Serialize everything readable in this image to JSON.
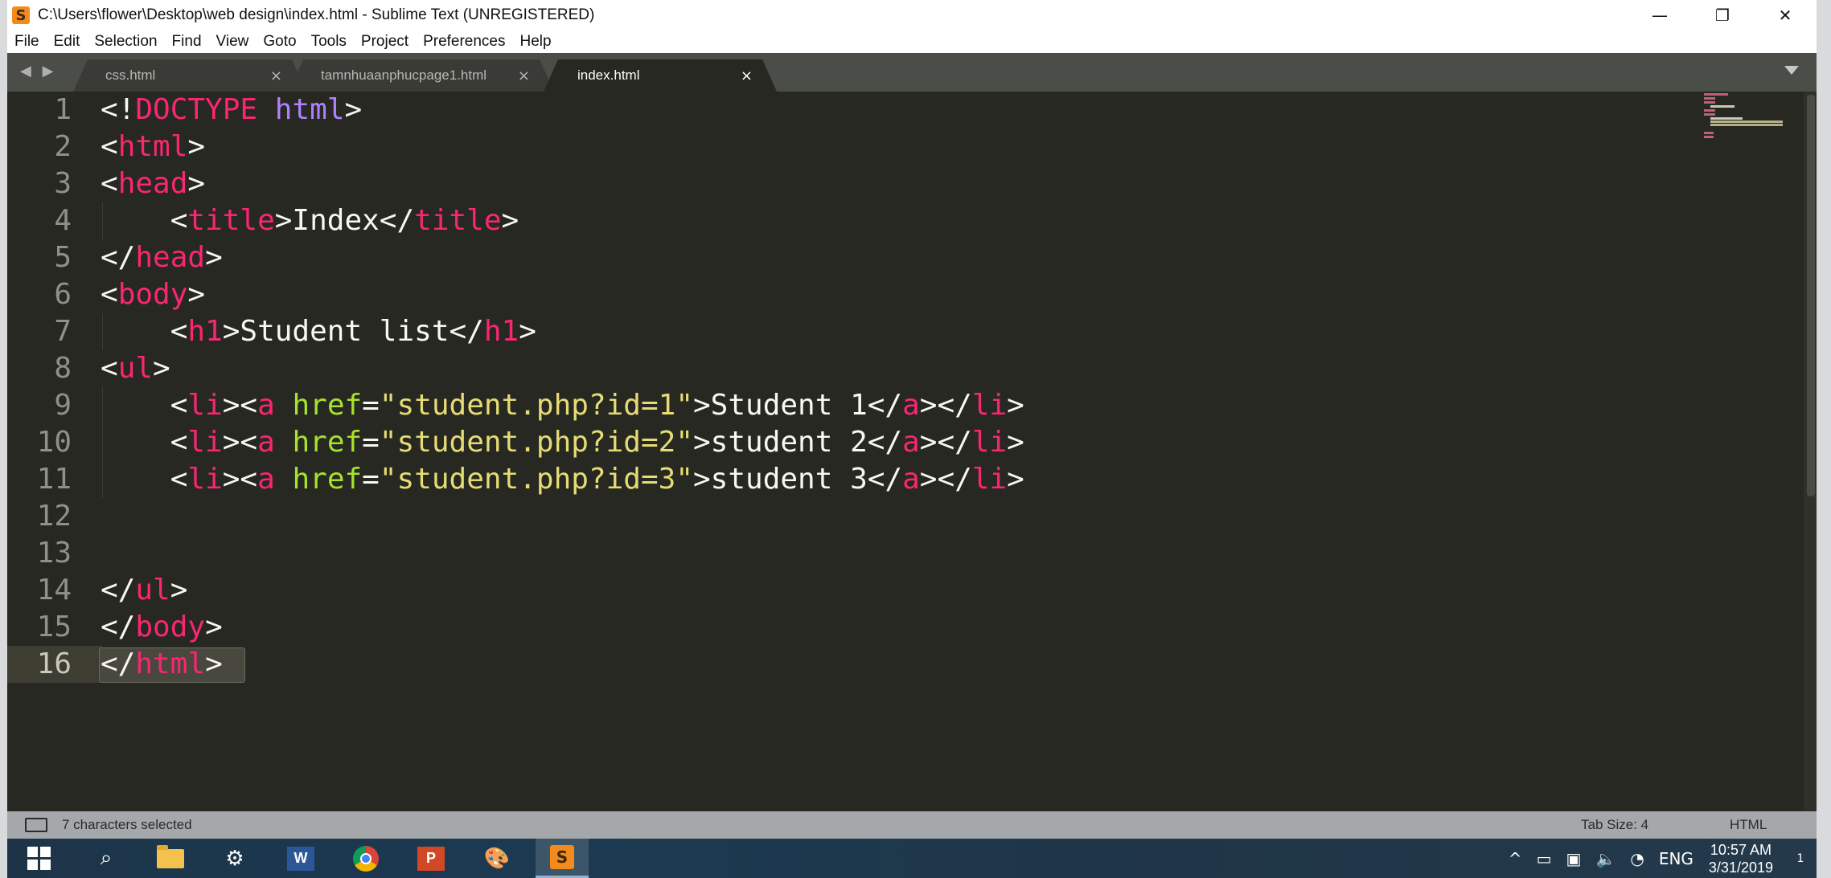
{
  "window": {
    "title": "C:\\Users\\flower\\Desktop\\web design\\index.html - Sublime Text (UNREGISTERED)",
    "app_icon_glyph": "S",
    "controls": {
      "minimize": "—",
      "restore": "❐",
      "close": "✕"
    }
  },
  "menu": [
    "File",
    "Edit",
    "Selection",
    "Find",
    "View",
    "Goto",
    "Tools",
    "Project",
    "Preferences",
    "Help"
  ],
  "tabs": {
    "nav_arrows": "◀ ▶",
    "items": [
      {
        "label": "css.html",
        "close": "×"
      },
      {
        "label": "tamnhuaanphucpage1.html",
        "close": "×"
      },
      {
        "label": "index.html",
        "close": "×",
        "active": true
      }
    ]
  },
  "editor": {
    "current_line": 16,
    "lines": [
      {
        "n": "1",
        "tokens": [
          {
            "t": "<!",
            "c": "plain"
          },
          {
            "t": "DOCTYPE",
            "c": "tag"
          },
          {
            "t": " ",
            "c": "plain"
          },
          {
            "t": "html",
            "c": "kw"
          },
          {
            "t": ">",
            "c": "plain"
          }
        ]
      },
      {
        "n": "2",
        "tokens": [
          {
            "t": "<",
            "c": "plain"
          },
          {
            "t": "html",
            "c": "tag"
          },
          {
            "t": ">",
            "c": "plain"
          }
        ]
      },
      {
        "n": "3",
        "tokens": [
          {
            "t": "<",
            "c": "plain"
          },
          {
            "t": "head",
            "c": "tag"
          },
          {
            "t": ">",
            "c": "plain"
          }
        ]
      },
      {
        "n": "4",
        "tokens": [
          {
            "t": "    <",
            "c": "plain"
          },
          {
            "t": "title",
            "c": "tag"
          },
          {
            "t": ">Index</",
            "c": "plain"
          },
          {
            "t": "title",
            "c": "tag"
          },
          {
            "t": ">",
            "c": "plain"
          }
        ]
      },
      {
        "n": "5",
        "tokens": [
          {
            "t": "</",
            "c": "plain"
          },
          {
            "t": "head",
            "c": "tag"
          },
          {
            "t": ">",
            "c": "plain"
          }
        ]
      },
      {
        "n": "6",
        "tokens": [
          {
            "t": "<",
            "c": "plain"
          },
          {
            "t": "body",
            "c": "tag"
          },
          {
            "t": ">",
            "c": "plain"
          }
        ]
      },
      {
        "n": "7",
        "tokens": [
          {
            "t": "    <",
            "c": "plain"
          },
          {
            "t": "h1",
            "c": "tag"
          },
          {
            "t": ">Student list</",
            "c": "plain"
          },
          {
            "t": "h1",
            "c": "tag"
          },
          {
            "t": ">",
            "c": "plain"
          }
        ]
      },
      {
        "n": "8",
        "tokens": [
          {
            "t": "<",
            "c": "plain"
          },
          {
            "t": "ul",
            "c": "tag"
          },
          {
            "t": ">",
            "c": "plain"
          }
        ]
      },
      {
        "n": "9",
        "tokens": [
          {
            "t": "    <",
            "c": "plain"
          },
          {
            "t": "li",
            "c": "tag"
          },
          {
            "t": "><",
            "c": "plain"
          },
          {
            "t": "a",
            "c": "tag"
          },
          {
            "t": " ",
            "c": "plain"
          },
          {
            "t": "href",
            "c": "attr"
          },
          {
            "t": "=",
            "c": "plain"
          },
          {
            "t": "\"student.php?id=1\"",
            "c": "str"
          },
          {
            "t": ">Student 1</",
            "c": "plain"
          },
          {
            "t": "a",
            "c": "tag"
          },
          {
            "t": "></",
            "c": "plain"
          },
          {
            "t": "li",
            "c": "tag"
          },
          {
            "t": ">",
            "c": "plain"
          }
        ]
      },
      {
        "n": "10",
        "tokens": [
          {
            "t": "    <",
            "c": "plain"
          },
          {
            "t": "li",
            "c": "tag"
          },
          {
            "t": "><",
            "c": "plain"
          },
          {
            "t": "a",
            "c": "tag"
          },
          {
            "t": " ",
            "c": "plain"
          },
          {
            "t": "href",
            "c": "attr"
          },
          {
            "t": "=",
            "c": "plain"
          },
          {
            "t": "\"student.php?id=2\"",
            "c": "str"
          },
          {
            "t": ">student 2</",
            "c": "plain"
          },
          {
            "t": "a",
            "c": "tag"
          },
          {
            "t": "></",
            "c": "plain"
          },
          {
            "t": "li",
            "c": "tag"
          },
          {
            "t": ">",
            "c": "plain"
          }
        ]
      },
      {
        "n": "11",
        "tokens": [
          {
            "t": "    <",
            "c": "plain"
          },
          {
            "t": "li",
            "c": "tag"
          },
          {
            "t": "><",
            "c": "plain"
          },
          {
            "t": "a",
            "c": "tag"
          },
          {
            "t": " ",
            "c": "plain"
          },
          {
            "t": "href",
            "c": "attr"
          },
          {
            "t": "=",
            "c": "plain"
          },
          {
            "t": "\"student.php?id=3\"",
            "c": "str"
          },
          {
            "t": ">student 3</",
            "c": "plain"
          },
          {
            "t": "a",
            "c": "tag"
          },
          {
            "t": "></",
            "c": "plain"
          },
          {
            "t": "li",
            "c": "tag"
          },
          {
            "t": ">",
            "c": "plain"
          }
        ]
      },
      {
        "n": "12",
        "tokens": []
      },
      {
        "n": "13",
        "tokens": []
      },
      {
        "n": "14",
        "tokens": [
          {
            "t": "</",
            "c": "plain"
          },
          {
            "t": "ul",
            "c": "tag"
          },
          {
            "t": ">",
            "c": "plain"
          }
        ]
      },
      {
        "n": "15",
        "tokens": [
          {
            "t": "</",
            "c": "plain"
          },
          {
            "t": "body",
            "c": "tag"
          },
          {
            "t": ">",
            "c": "plain"
          }
        ]
      },
      {
        "n": "16",
        "tokens": [
          {
            "t": "</",
            "c": "plain"
          },
          {
            "t": "html",
            "c": "tag"
          },
          {
            "t": ">",
            "c": "plain"
          }
        ]
      }
    ]
  },
  "status": {
    "selection": "7 characters selected",
    "tab_size": "Tab Size: 4",
    "syntax": "HTML"
  },
  "taskbar": {
    "apps": [
      "start-icon",
      "search-icon",
      "file-explorer-icon",
      "settings-icon",
      "word-icon",
      "chrome-icon",
      "powerpoint-icon",
      "paint-icon",
      "sublime-text-icon"
    ],
    "word_glyph": "W",
    "ppt_glyph": "P",
    "sublime_glyph": "S",
    "tray": {
      "chevron": "^",
      "language": "ENG",
      "time": "10:57 AM",
      "date": "3/31/2019",
      "notifications": "1"
    }
  },
  "colors": {
    "editor_bg": "#272822",
    "tag": "#f92672",
    "attr": "#a6e22e",
    "string": "#e6db74",
    "keyword": "#ae81ff",
    "plain": "#f8f8f2"
  }
}
